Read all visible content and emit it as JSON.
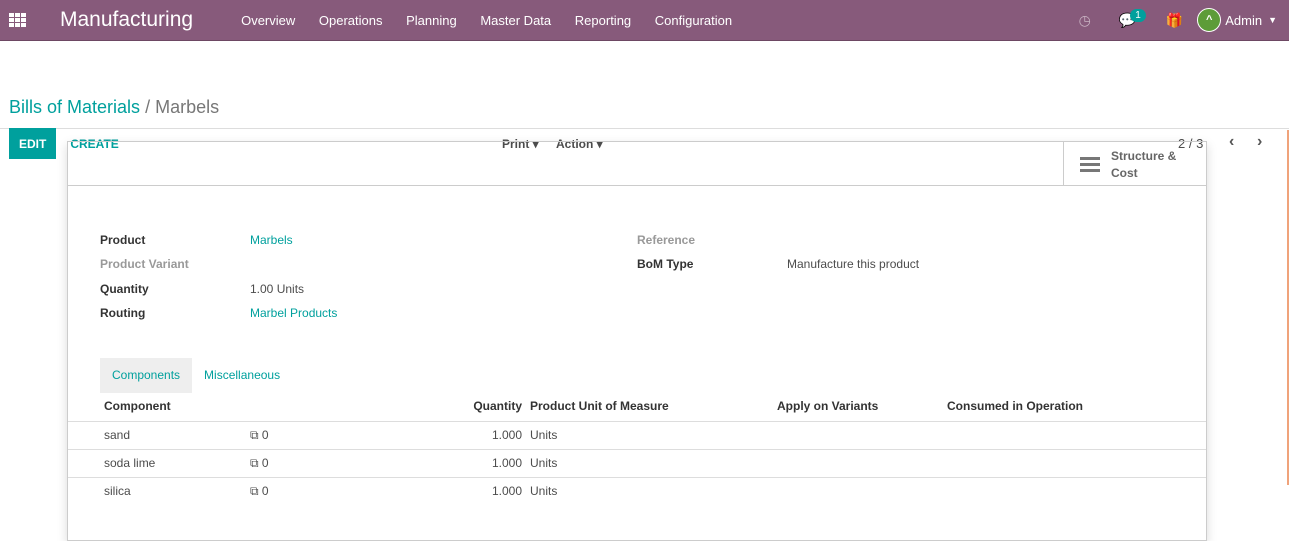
{
  "nav": {
    "brand": "Manufacturing",
    "menu": [
      "Overview",
      "Operations",
      "Planning",
      "Master Data",
      "Reporting",
      "Configuration"
    ],
    "badge": "1",
    "user": "Admin"
  },
  "breadcrumb": {
    "parent": "Bills of Materials",
    "sep": "/",
    "current": "Marbels"
  },
  "toolbar": {
    "edit": "EDIT",
    "create": "CREATE",
    "print": "Print ▾",
    "action": "Action ▾",
    "pager": "2 / 3",
    "prev": "‹",
    "next": "›"
  },
  "button_box": {
    "structure": "Structure &",
    "structure2": "Cost"
  },
  "form": {
    "product_label": "Product",
    "product": "Marbels",
    "variant_label": "Product Variant",
    "quantity_label": "Quantity",
    "quantity": "1.00",
    "uom": "Units",
    "routing_label": "Routing",
    "routing": "Marbel Products",
    "reference_label": "Reference",
    "bom_type_label": "BoM Type",
    "bom_type": "Manufacture this product"
  },
  "tabs": [
    "Components",
    "Miscellaneous"
  ],
  "table": {
    "headers": [
      "Component",
      "",
      "Quantity",
      "Product Unit of Measure",
      "Apply on Variants",
      "Consumed in Operation"
    ],
    "rows": [
      {
        "component": "sand",
        "count": "0",
        "qty": "1.000",
        "uom": "Units"
      },
      {
        "component": "soda lime",
        "count": "0",
        "qty": "1.000",
        "uom": "Units"
      },
      {
        "component": "silica",
        "count": "0",
        "qty": "1.000",
        "uom": "Units"
      }
    ]
  }
}
